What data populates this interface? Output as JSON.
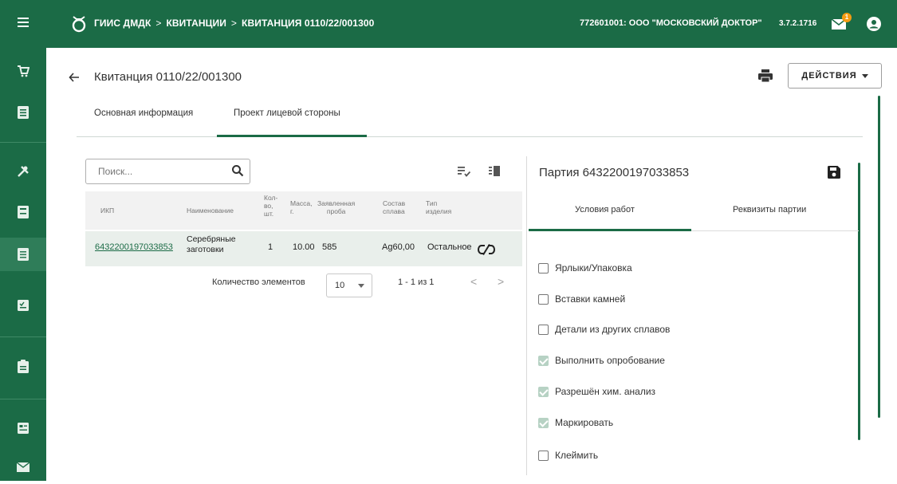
{
  "topbar": {
    "breadcrumbs": [
      "ГИИС ДМДК",
      "КВИТАНЦИИ",
      "КВИТАНЦИЯ 0110/22/001300"
    ],
    "separator": ">",
    "organization": "772601001: ООО \"МОСКОВСКИЙ ДОКТОР\"",
    "version": "3.7.2.1716",
    "mail_badge": "1",
    "color": "#1b6b46"
  },
  "sidebar": {
    "items": [
      "cart-icon",
      "list-icon",
      "tools-icon",
      "archive-icon",
      "document-icon",
      "checklist-icon",
      "clipboard-icon",
      "card-icon",
      "mail-icon"
    ],
    "active_index": 4
  },
  "header": {
    "title": "Квитанция 0110/22/001300",
    "actions_label": "ДЕЙСТВИЯ"
  },
  "tabs": [
    {
      "label": "Основная информация"
    },
    {
      "label": "Проект лицевой стороны",
      "active": true
    }
  ],
  "search": {
    "placeholder": "Поиск..."
  },
  "table": {
    "headers": {
      "ikp": "ИКП",
      "name": "Наименование",
      "qty": [
        "Кол-",
        "во,",
        "шт."
      ],
      "mass": [
        "Масса,",
        "г."
      ],
      "proba": [
        "Заявленная",
        "проба"
      ],
      "alloy": [
        "Состав",
        "сплава"
      ],
      "type": [
        "Тип",
        "изделия"
      ]
    },
    "rows": [
      {
        "ikp": "6432200197033853",
        "name": [
          "Серебряные",
          "заготовки"
        ],
        "qty": "1",
        "mass": "10.00",
        "proba": "585",
        "alloy": "Ag60,00",
        "type": "Остальное"
      }
    ]
  },
  "pagination": {
    "count_label": "Количество элементов",
    "page_size": "10",
    "range": "1 - 1 из 1",
    "prev": "<",
    "next": ">"
  },
  "batch": {
    "title": "Партия 6432200197033853",
    "subtabs": [
      {
        "label": "Условия работ",
        "active": true
      },
      {
        "label": "Реквизиты партии"
      }
    ],
    "options": [
      {
        "label": "Ярлыки/Упаковка",
        "checked": false
      },
      {
        "label": "Вставки камней",
        "checked": false
      },
      {
        "label": "Детали из других сплавов",
        "checked": false
      },
      {
        "label": "Выполнить опробование",
        "checked": true
      },
      {
        "label": "Разрешён хим. анализ",
        "checked": true
      },
      {
        "label": "Маркировать",
        "checked": true
      },
      {
        "label": "Клеймить",
        "checked": false
      }
    ]
  }
}
